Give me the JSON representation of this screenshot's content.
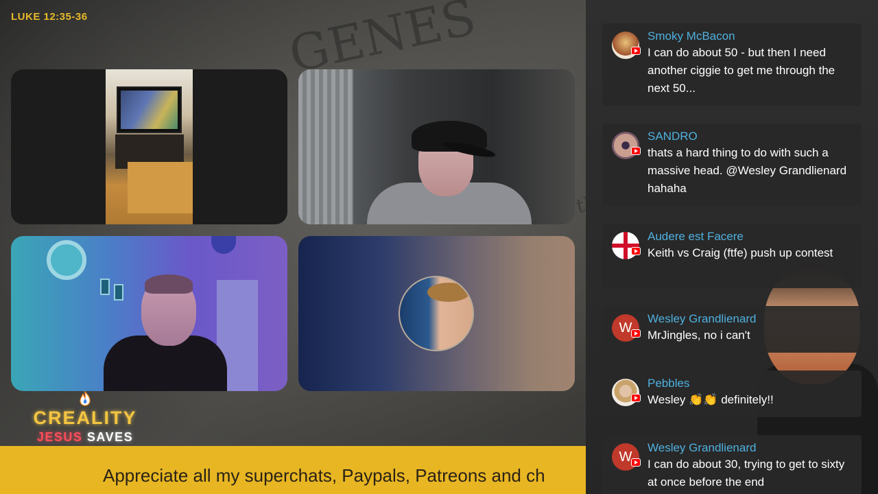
{
  "overlay": {
    "verse": "LUKE 12:35-36"
  },
  "brand": {
    "title": "CREALITY",
    "sub_red": "JESUS",
    "sub_white": "SAVES"
  },
  "ticker": {
    "text": "Appreciate all my superchats, Paypals, Patreons and ch"
  },
  "colors": {
    "accent_gold": "#e8b623",
    "chat_name": "#4fb1e0",
    "youtube_red": "#ff0000"
  },
  "chat": {
    "messages": [
      {
        "author": "Smoky McBacon",
        "text": "I can do about 50 - but then I need another ciggie to get me through the next 50...",
        "avatar": "photo",
        "avatar_icon": "burger-avatar-icon"
      },
      {
        "author": "SANDRO",
        "text": "thats a hard thing to do with such a massive head. @Wesley Grandlienard hahaha",
        "avatar": "photo",
        "avatar_icon": "eye-avatar-icon"
      },
      {
        "author": "Audere est Facere",
        "text": "Keith vs Craig (ftfe) push up contest",
        "avatar": "photo",
        "avatar_icon": "england-flag-icon"
      },
      {
        "author": "Wesley Grandlienard",
        "text": "MrJingles, no i can't",
        "avatar_letter": "W"
      },
      {
        "author": "Pebbles",
        "text": "Wesley 👏👏 definitely!!",
        "avatar": "photo",
        "avatar_icon": "woman-avatar-icon"
      },
      {
        "author": "Wesley Grandlienard",
        "text": "I can do about 30, trying to get to sixty at once before the end",
        "avatar_letter": "W"
      }
    ]
  }
}
